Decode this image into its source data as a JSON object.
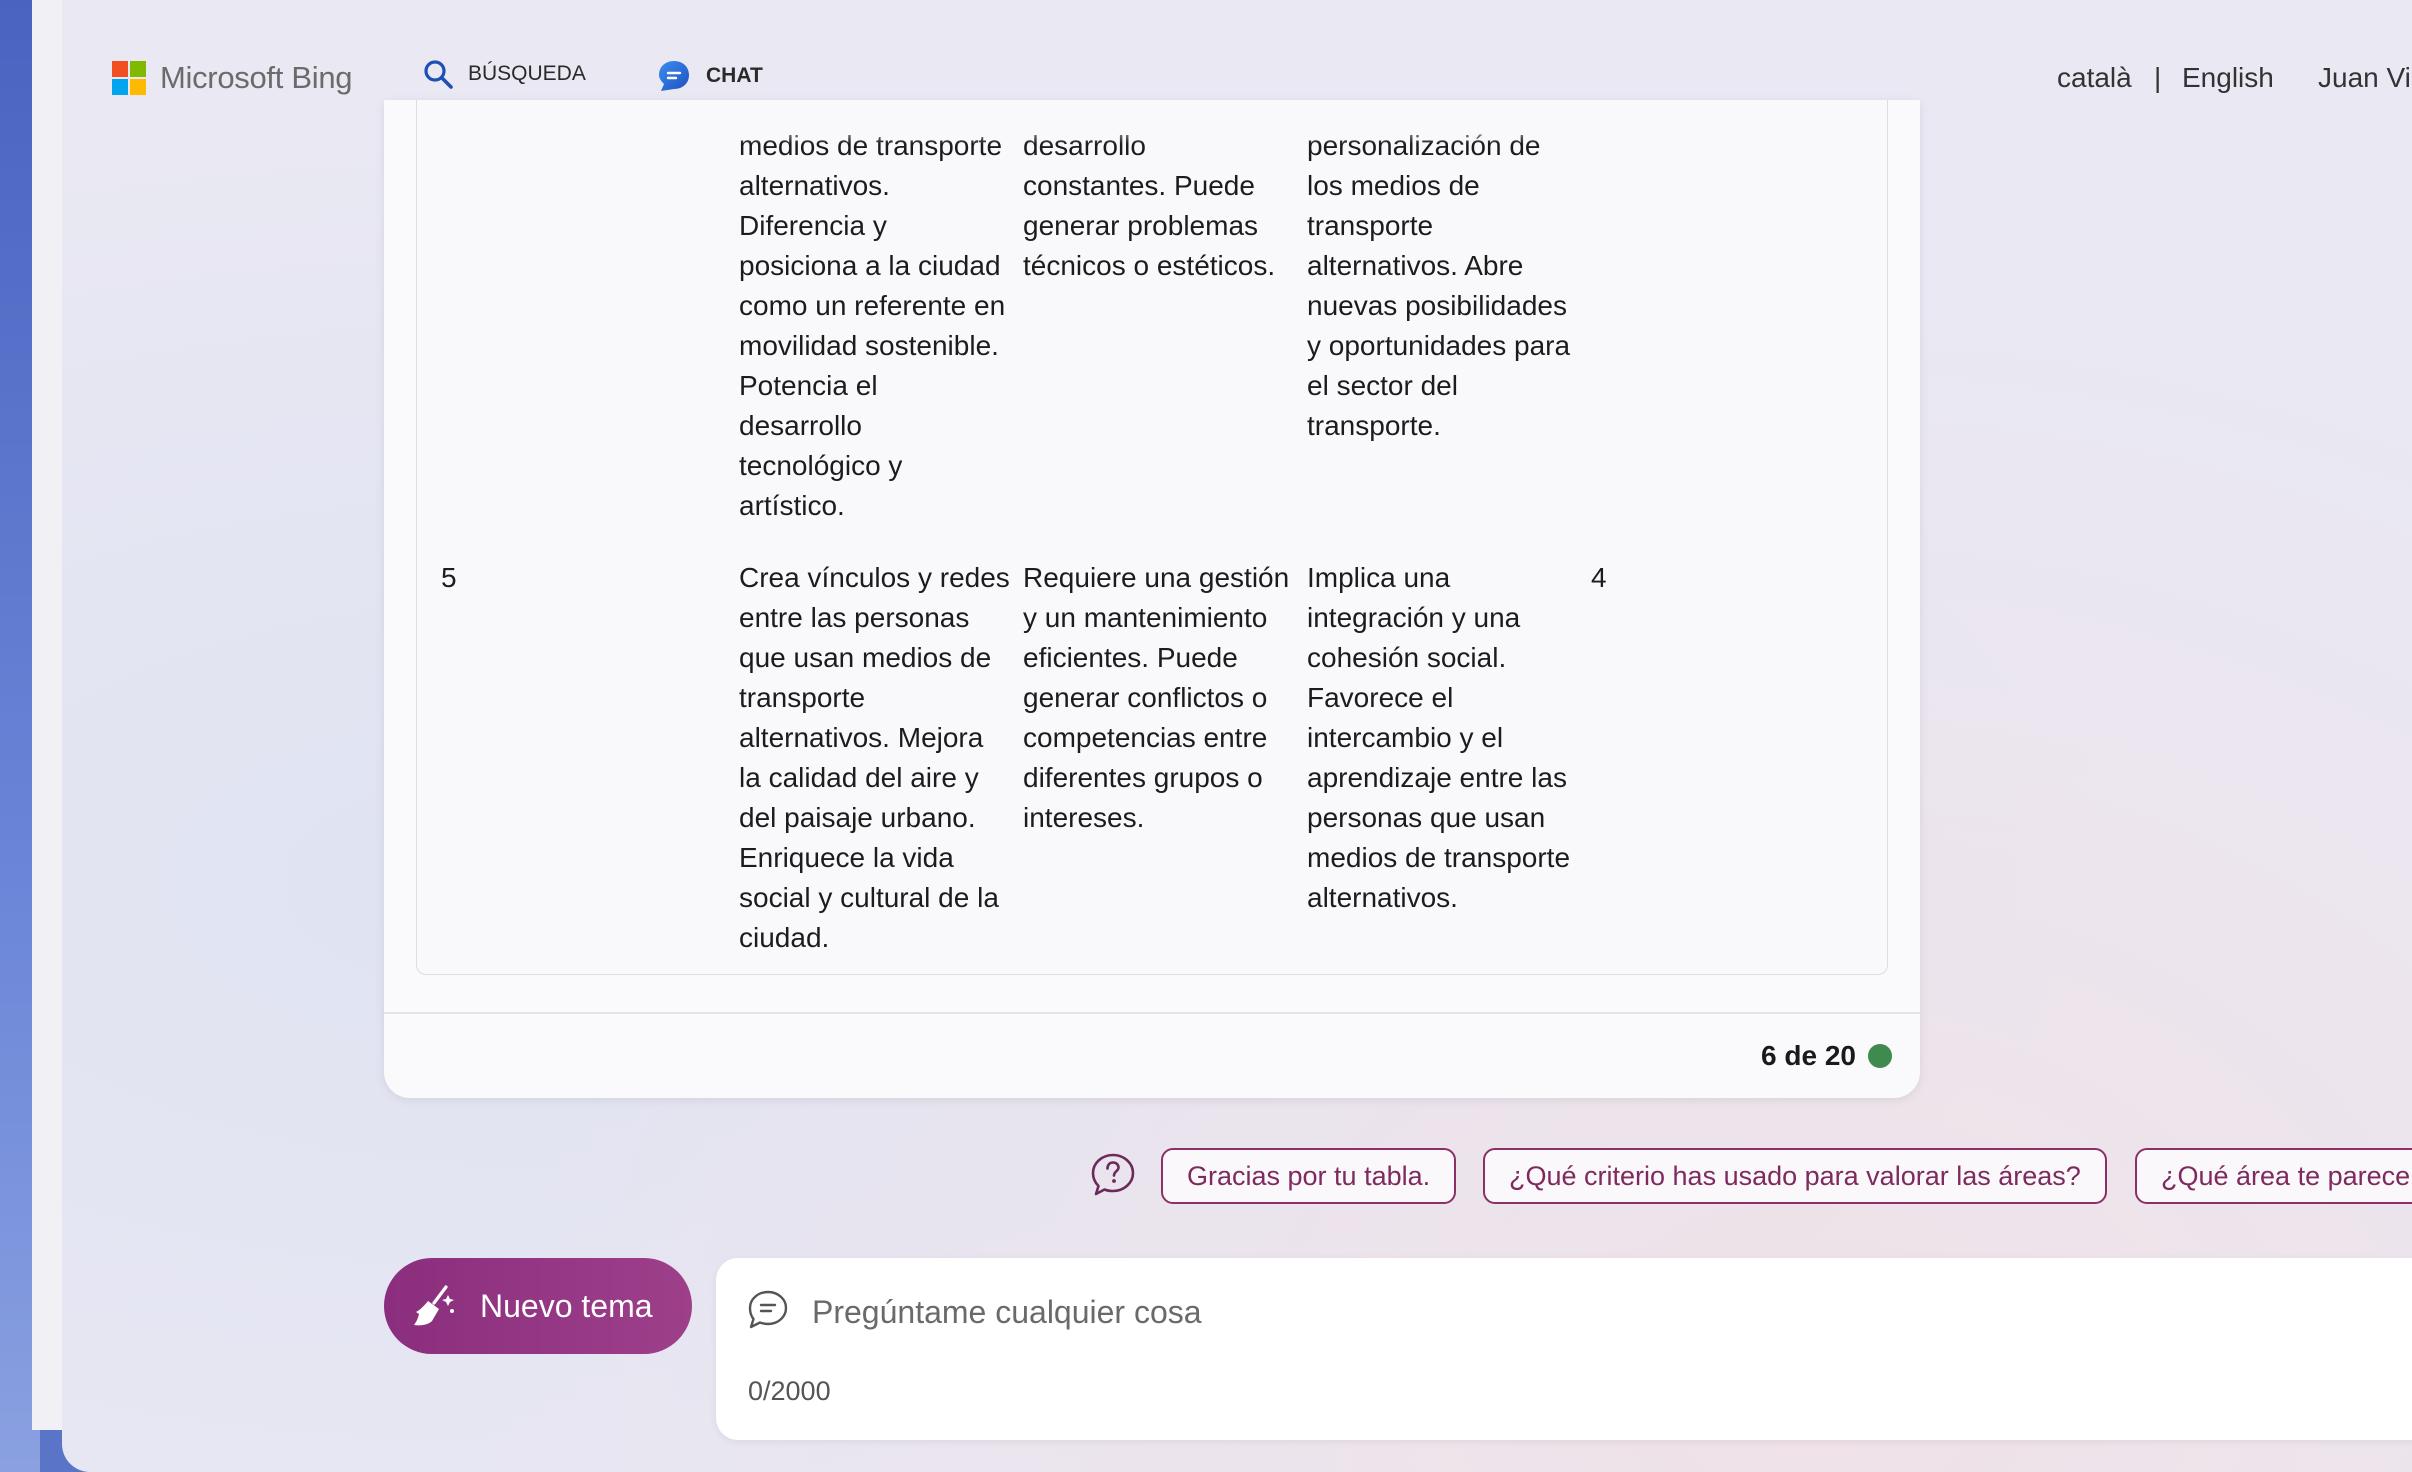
{
  "header": {
    "brand": "Microsoft Bing",
    "tabs": [
      {
        "label": "BÚSQUEDA",
        "icon": "search-icon",
        "active": false
      },
      {
        "label": "CHAT",
        "icon": "chat-bubble-icon",
        "active": true
      }
    ],
    "languages": [
      "català",
      "English"
    ],
    "language_separator": "|",
    "user_name": "Juan Vi"
  },
  "table": {
    "rows": [
      {
        "number": "",
        "col_b": [
          "medios de transporte",
          "alternativos.",
          "Diferencia y",
          "posiciona a la ciudad",
          "como un referente en",
          "movilidad sostenible.",
          "Potencia el",
          "desarrollo",
          "tecnológico y",
          "artístico."
        ],
        "col_c": [
          "desarrollo",
          "constantes. Puede",
          "generar problemas",
          "técnicos o estéticos."
        ],
        "col_d": [
          "personalización de",
          "los medios de",
          "transporte",
          "alternativos. Abre",
          "nuevas posibilidades",
          "y oportunidades para",
          "el sector del",
          "transporte."
        ],
        "score": ""
      },
      {
        "number": "5",
        "col_b": [
          "Crea vínculos y redes",
          "entre las personas",
          "que usan medios de",
          "transporte",
          "alternativos. Mejora",
          "la calidad del aire y",
          "del paisaje urbano.",
          "Enriquece la vida",
          "social y cultural de la",
          "ciudad."
        ],
        "col_c": [
          "Requiere una gestión",
          "y un mantenimiento",
          "eficientes. Puede",
          "generar conflictos o",
          "competencias entre",
          "diferentes grupos o",
          "intereses."
        ],
        "col_d": [
          "Implica una",
          "integración y una",
          "cohesión social.",
          "Favorece el",
          "intercambio y el",
          "aprendizaje entre las",
          "personas que usan",
          "medios de transporte",
          "alternativos."
        ],
        "score": "4"
      }
    ]
  },
  "response_counter": "6 de 20",
  "status_color": "#3f8a4e",
  "suggestions": [
    "Gracias por tu tabla.",
    "¿Qué criterio has usado para valorar las áreas?",
    "¿Qué área te parece"
  ],
  "new_topic_label": "Nuevo tema",
  "input": {
    "placeholder": "Pregúntame cualquier cosa",
    "value": "",
    "char_count": "0/2000"
  },
  "colors": {
    "accent": "#8a2e7d",
    "chat_underline": "#1e4fb5",
    "chip_border": "#8a2f68"
  }
}
